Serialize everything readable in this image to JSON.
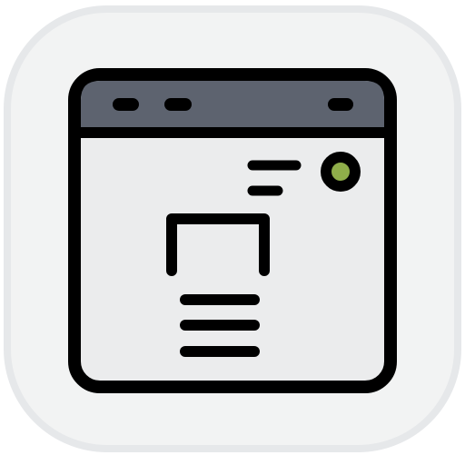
{
  "icon": {
    "name": "browser-window-layout-icon",
    "colors": {
      "tile_background": "#f2f3f3",
      "tile_border": "#e6e8ea",
      "window_fill": "#ebeced",
      "title_bar": "#5d636f",
      "outline": "#000000",
      "status_dot": "#8fae4a"
    },
    "elements": [
      "title-bar-dot-icon",
      "title-bar-dot-icon",
      "title-bar-dash-icon",
      "text-lines-icon",
      "status-dot-icon",
      "frame-bracket-icon",
      "stacked-lines-icon"
    ]
  }
}
